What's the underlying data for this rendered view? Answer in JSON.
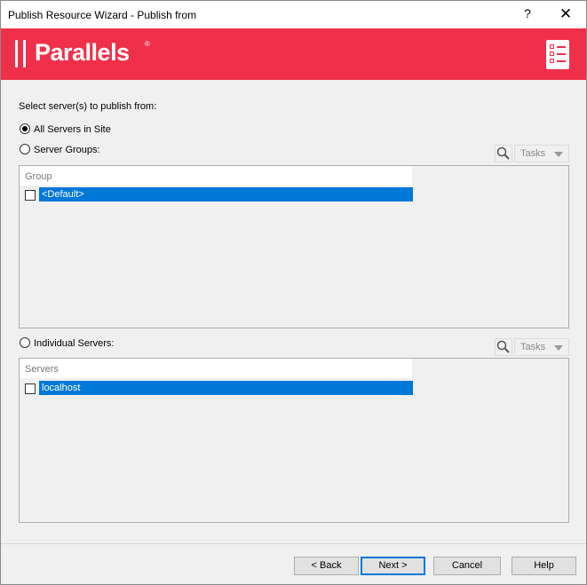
{
  "window": {
    "title": "Publish Resource Wizard - Publish from",
    "help_glyph": "?",
    "close_glyph": "✕"
  },
  "banner": {
    "logo_text": "Parallels",
    "logo_mark": "®",
    "icon": "checklist-icon"
  },
  "prompt": "Select server(s) to publish from:",
  "options": {
    "all_servers": "All Servers in Site",
    "server_groups": "Server Groups:",
    "individual_servers": "Individual Servers:"
  },
  "toolbar": {
    "tasks_label": "Tasks",
    "search_icon": "search-icon"
  },
  "groups_table": {
    "column": "Group",
    "rows": [
      {
        "name": "<Default>",
        "checked": false,
        "selected": true
      }
    ]
  },
  "servers_table": {
    "column": "Servers",
    "rows": [
      {
        "name": "localhost",
        "checked": false,
        "selected": true
      }
    ]
  },
  "buttons": {
    "back": "< Back",
    "next": "Next >",
    "cancel": "Cancel",
    "help": "Help"
  },
  "colors": {
    "brand": "#f0304a",
    "selection": "#0078d7"
  }
}
